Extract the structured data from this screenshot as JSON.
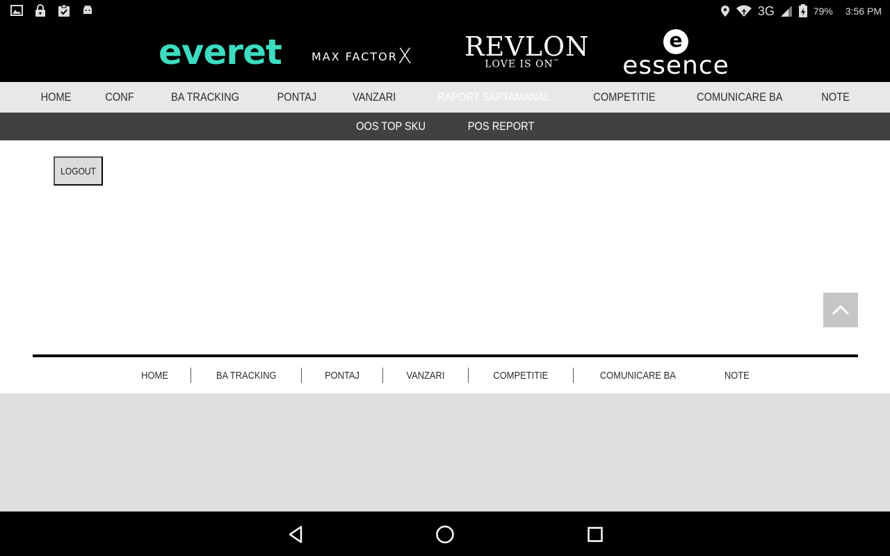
{
  "status_bar": {
    "left_icons": [
      "image-icon",
      "lock-icon",
      "clipboard-check-icon",
      "android-icon"
    ],
    "battery": "79%",
    "time": "3:56 PM",
    "network": "3G"
  },
  "brands": {
    "everet": "everet",
    "max_factor": "MAX FACTOR",
    "max_factor_mark": "X",
    "revlon": "REVLON",
    "revlon_tagline": "LOVE IS ON",
    "revlon_tm": "™",
    "essence_mark": "e",
    "essence": "essence",
    "everet_color": "#3ddcc0"
  },
  "main_nav": {
    "items": [
      {
        "label": "HOME"
      },
      {
        "label": "CONF"
      },
      {
        "label": "BA TRACKING"
      },
      {
        "label": "PONTAJ"
      },
      {
        "label": "VANZARI"
      },
      {
        "label": "RAPORT SAPTAMANAL"
      },
      {
        "label": "COMPETITIE"
      },
      {
        "label": "COMUNICARE BA"
      },
      {
        "label": "NOTE"
      }
    ],
    "active_index": 5
  },
  "sub_nav": {
    "items": [
      {
        "label": "OOS TOP SKU"
      },
      {
        "label": "POS REPORT"
      }
    ]
  },
  "content": {
    "logout_label": "LOGOUT"
  },
  "footer_nav": {
    "items": [
      {
        "label": "HOME"
      },
      {
        "label": "BA TRACKING"
      },
      {
        "label": "PONTAJ"
      },
      {
        "label": "VANZARI"
      },
      {
        "label": "COMPETITIE"
      },
      {
        "label": "COMUNICARE BA"
      },
      {
        "label": "NOTE"
      }
    ]
  },
  "android_nav": {
    "buttons": [
      "back-icon",
      "home-icon",
      "recents-icon"
    ]
  }
}
